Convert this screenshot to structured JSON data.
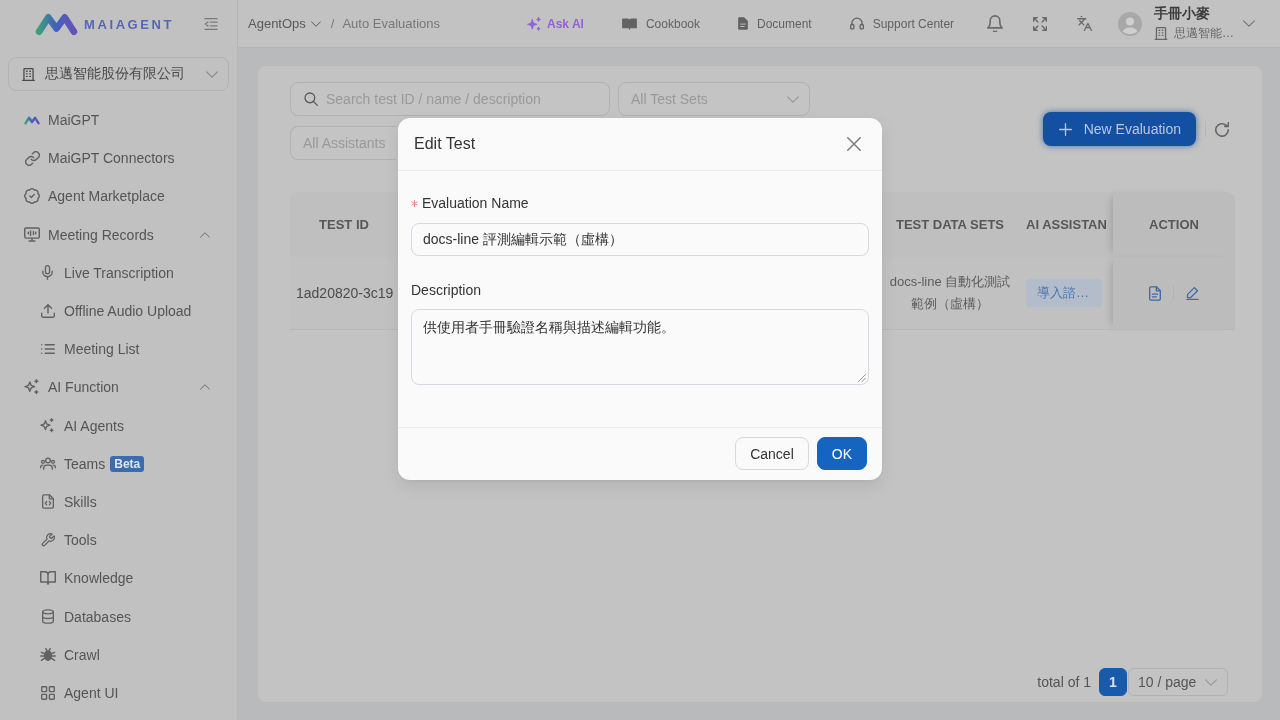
{
  "sidebar": {
    "logo_text": "MAIAGENT",
    "organization": "思邁智能股份有限公司",
    "items": [
      {
        "label": "MaiGPT",
        "selected": false
      },
      {
        "label": "MaiGPT Connectors",
        "selected": false
      },
      {
        "label": "Agent Marketplace",
        "selected": false
      },
      {
        "label": "Meeting Records",
        "selected": false,
        "expanded": true,
        "children": [
          {
            "label": "Live Transcription",
            "selected": false
          },
          {
            "label": "Offline Audio Upload",
            "selected": false
          },
          {
            "label": "Meeting List",
            "selected": false
          }
        ]
      },
      {
        "label": "AI Function",
        "selected": false,
        "expanded": true,
        "children": [
          {
            "label": "AI Agents",
            "selected": false
          },
          {
            "label": "Teams",
            "badge": "Beta",
            "selected": false
          },
          {
            "label": "Skills",
            "selected": false
          },
          {
            "label": "Tools",
            "selected": false
          },
          {
            "label": "Knowledge",
            "selected": false
          },
          {
            "label": "Databases",
            "selected": false
          },
          {
            "label": "Crawl",
            "selected": false
          },
          {
            "label": "Agent UI",
            "selected": false
          }
        ]
      }
    ]
  },
  "header": {
    "breadcrumb": [
      {
        "label": "AgentOps",
        "dropdown": true
      },
      {
        "label": "Auto Evaluations",
        "dropdown": false
      }
    ],
    "breadcrumb_separator": "/",
    "nav": [
      {
        "label": "Ask AI",
        "kind": "ai"
      },
      {
        "label": "Cookbook",
        "kind": "link"
      },
      {
        "label": "Document",
        "kind": "link"
      },
      {
        "label": "Support Center",
        "kind": "link"
      }
    ],
    "user": {
      "name": "手冊小麥",
      "organization": "思邁智能…"
    }
  },
  "filters": {
    "search": {
      "placeholder": "Search test ID / name / description"
    },
    "test_set": {
      "placeholder": "All Test Sets"
    },
    "assistant": {
      "placeholder": "All Assistants"
    }
  },
  "new_button": {
    "label": "New Evaluation"
  },
  "table": {
    "columns": [
      "TEST ID",
      "TEST DATA SETS",
      "AI ASSISTAN",
      "ACTION"
    ],
    "rows": [
      {
        "test_id": "1ad20820-3c19",
        "test_data_sets": "docs-line 自動化測試範例（虛構）",
        "ai_assistants": [
          "導入諮…"
        ]
      }
    ]
  },
  "pagination": {
    "total": "total of 1",
    "pages": [
      {
        "label": "1",
        "selected": true
      }
    ],
    "page_size": "10 / page"
  },
  "dialog": {
    "title": "Edit Test",
    "fields": [
      {
        "label": "Evaluation Name",
        "required": true,
        "kind": "input",
        "value": "docs-line 評測編輯示範（虛構）"
      },
      {
        "label": "Description",
        "required": false,
        "kind": "textarea",
        "value": "供使用者手冊驗證名稱與描述編輯功能。"
      }
    ],
    "buttons": [
      {
        "label": "Cancel",
        "kind": "cancel"
      },
      {
        "label": "OK",
        "kind": "confirm"
      }
    ]
  }
}
